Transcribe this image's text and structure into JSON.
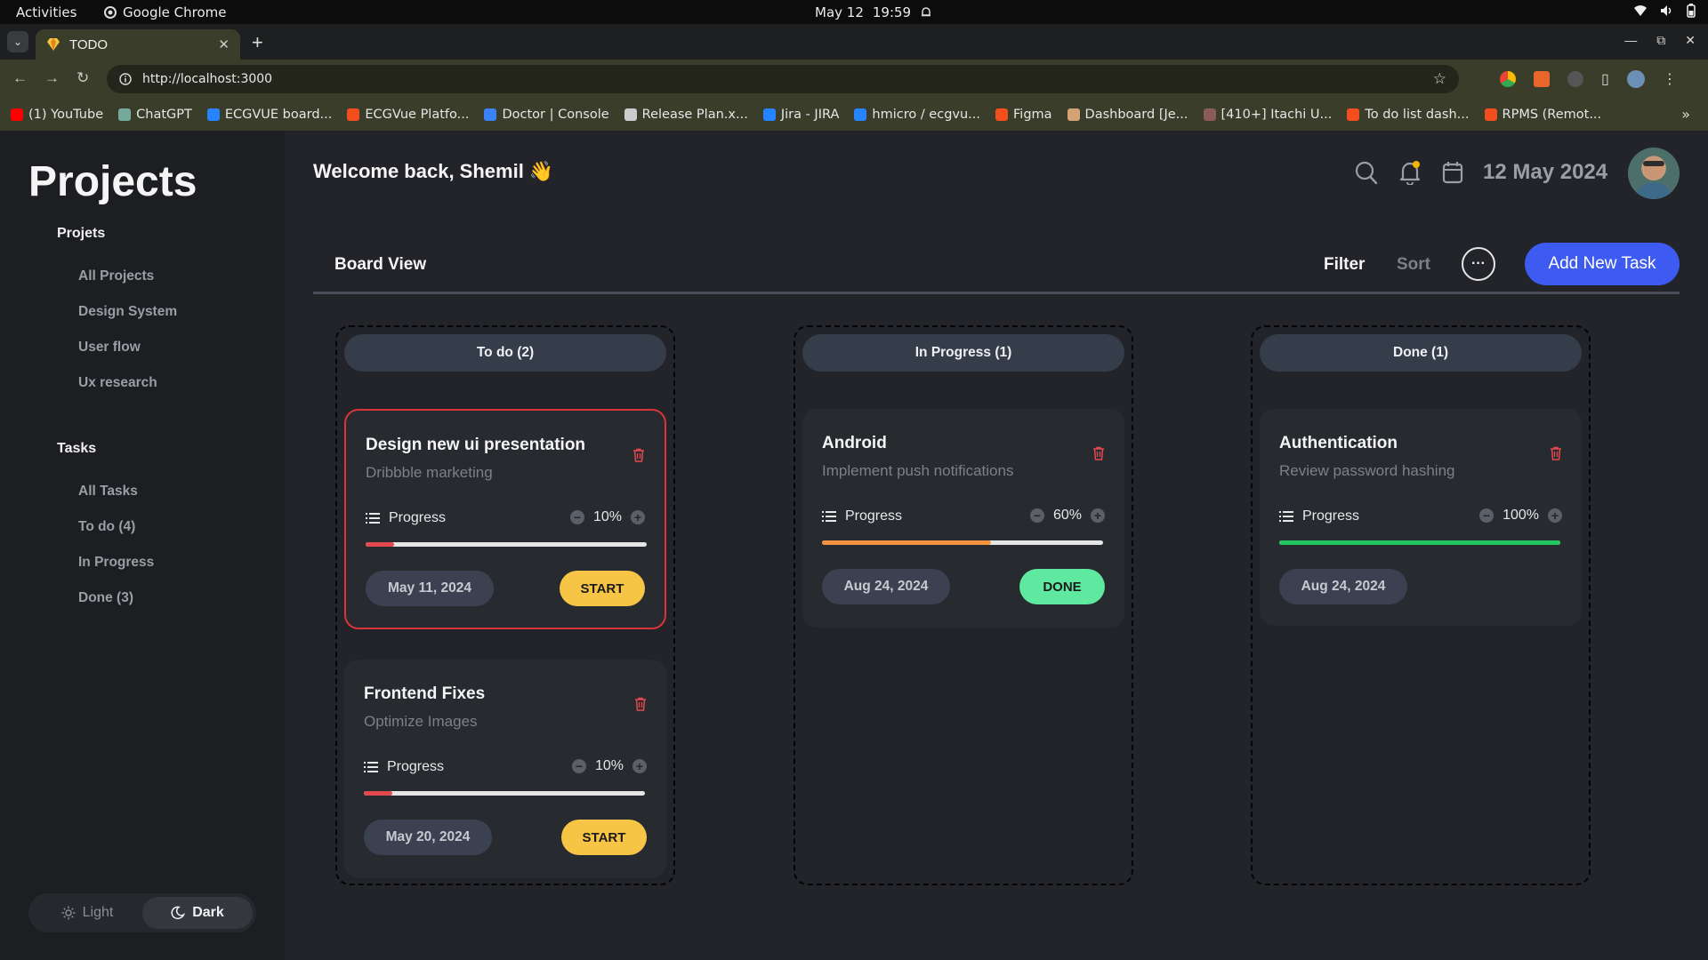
{
  "os": {
    "activities": "Activities",
    "app": "Google Chrome",
    "date": "May 12",
    "time": "19:59"
  },
  "browser": {
    "tab_title": "TODO",
    "url": "http://localhost:3000",
    "bookmarks": [
      {
        "label": "(1) YouTube",
        "color": "#ff0000"
      },
      {
        "label": "ChatGPT",
        "color": "#74aa9c"
      },
      {
        "label": "ECGVUE board...",
        "color": "#2684ff"
      },
      {
        "label": "ECGVue Platfo...",
        "color": "#f24e1e"
      },
      {
        "label": "Doctor | Console",
        "color": "#3b82f6"
      },
      {
        "label": "Release Plan.x...",
        "color": "#cccccc"
      },
      {
        "label": "Jira - JIRA",
        "color": "#2684ff"
      },
      {
        "label": "hmicro / ecgvu...",
        "color": "#2684ff"
      },
      {
        "label": "Figma",
        "color": "#f24e1e"
      },
      {
        "label": "Dashboard [Je...",
        "color": "#d4a373"
      },
      {
        "label": "[410+] Itachi U...",
        "color": "#8b5a5a"
      },
      {
        "label": "To do list dash...",
        "color": "#f24e1e"
      },
      {
        "label": "RPMS (Remot...",
        "color": "#f24e1e"
      }
    ]
  },
  "sidebar": {
    "brand": "Projects",
    "projects_heading": "Projets",
    "project_items": [
      "All Projects",
      "Design System",
      "User flow",
      "Ux research"
    ],
    "tasks_heading": "Tasks",
    "task_items": [
      "All Tasks",
      "To do (4)",
      "In Progress",
      "Done (3)"
    ],
    "theme": {
      "light": "Light",
      "dark": "Dark",
      "active": "dark"
    }
  },
  "header": {
    "welcome": "Welcome back, Shemil 👋",
    "date": "12 May 2024"
  },
  "board": {
    "title": "Board View",
    "filter": "Filter",
    "sort": "Sort",
    "add_button": "Add New Task",
    "progress_label": "Progress",
    "columns": [
      {
        "title": "To do (2)",
        "cards": [
          {
            "title": "Design new ui presentation",
            "subtitle": "Dribbble marketing",
            "percent": "10%",
            "progress": 10,
            "bar_color": "#e5484d",
            "date": "May 11, 2024",
            "action": "START",
            "action_type": "start",
            "selected": true
          },
          {
            "title": "Frontend Fixes",
            "subtitle": "Optimize Images",
            "percent": "10%",
            "progress": 10,
            "bar_color": "#e5484d",
            "date": "May 20, 2024",
            "action": "START",
            "action_type": "start",
            "selected": false
          }
        ]
      },
      {
        "title": "In Progress (1)",
        "cards": [
          {
            "title": "Android",
            "subtitle": "Implement push notifications",
            "percent": "60%",
            "progress": 60,
            "bar_color": "#f5923e",
            "date": "Aug 24, 2024",
            "action": "DONE",
            "action_type": "done",
            "selected": false
          }
        ]
      },
      {
        "title": "Done (1)",
        "cards": [
          {
            "title": "Authentication",
            "subtitle": "Review password hashing",
            "percent": "100%",
            "progress": 100,
            "bar_color": "#22c55e",
            "date": "Aug 24, 2024",
            "action": "",
            "action_type": "none",
            "selected": false
          }
        ]
      }
    ]
  }
}
